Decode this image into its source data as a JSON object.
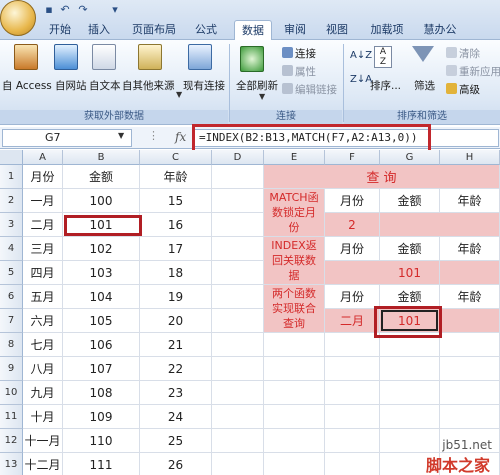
{
  "quick_access": {
    "save_icon": "save-icon",
    "undo_icon": "undo-icon",
    "redo_icon": "redo-icon"
  },
  "tabs": [
    "开始",
    "插入",
    "页面布局",
    "公式",
    "数据",
    "审阅",
    "视图",
    "加载项",
    "慧办公"
  ],
  "active_tab": "数据",
  "ribbon": {
    "external": {
      "buttons": [
        "自 Access",
        "自网站",
        "自文本",
        "自其他来源"
      ],
      "existing": "现有连接",
      "label": "获取外部数据"
    },
    "connections": {
      "refresh": "全部刷新",
      "items": [
        "连接",
        "属性",
        "编辑链接"
      ],
      "label": "连接"
    },
    "sort_filter": {
      "sort": "排序...",
      "filter": "筛选",
      "items": [
        "清除",
        "重新应用",
        "高级"
      ],
      "label": "排序和筛选"
    }
  },
  "formula_bar": {
    "name_box": "G7",
    "fx": "fx",
    "formula": "=INDEX(B2:B13,MATCH(F7,A2:A13,0))"
  },
  "grid": {
    "columns": [
      "A",
      "B",
      "C",
      "D",
      "E",
      "F",
      "G",
      "H"
    ],
    "rows": [
      "1",
      "2",
      "3",
      "4",
      "5",
      "6",
      "7",
      "8",
      "9",
      "10",
      "11",
      "12",
      "13"
    ],
    "left_table": {
      "headers": [
        "月份",
        "金额",
        "年龄"
      ],
      "rows": [
        [
          "一月",
          "100",
          "15"
        ],
        [
          "二月",
          "101",
          "16"
        ],
        [
          "三月",
          "102",
          "17"
        ],
        [
          "四月",
          "103",
          "18"
        ],
        [
          "五月",
          "104",
          "19"
        ],
        [
          "六月",
          "105",
          "20"
        ],
        [
          "七月",
          "106",
          "21"
        ],
        [
          "八月",
          "107",
          "22"
        ],
        [
          "九月",
          "108",
          "23"
        ],
        [
          "十月",
          "109",
          "24"
        ],
        [
          "十一月",
          "110",
          "25"
        ],
        [
          "十二月",
          "111",
          "26"
        ]
      ]
    },
    "query": {
      "title": "查 询",
      "match_label": "MATCH函数锁定月份",
      "index_label": "INDEX返回关联数据",
      "combo_label": "两个函数实现联合查询",
      "col_headers": [
        "月份",
        "金额",
        "年龄"
      ],
      "match_result": "2",
      "index_result": "101",
      "combo_month": "二月",
      "combo_result": "101"
    }
  },
  "watermark": {
    "line1": "jb51.net",
    "line2": "脚本之家"
  },
  "colors": {
    "accent": "#c1272d",
    "pink": "#f2c4c4",
    "red_text": "#d42a2a"
  }
}
